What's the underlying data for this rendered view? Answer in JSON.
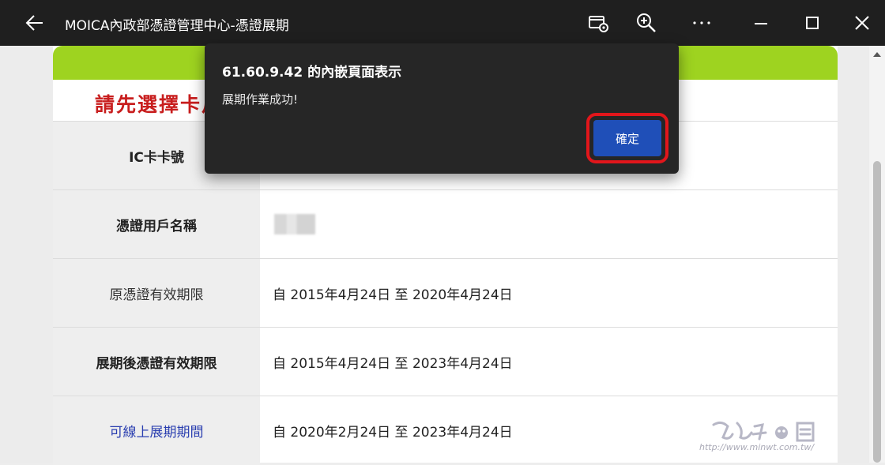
{
  "window": {
    "title": "MOICA內政部憑證管理中心-憑證展期"
  },
  "titlebar_icons": [
    "back-arrow-icon",
    "app-settings-icon",
    "zoom-in-icon",
    "more-icon",
    "minimize-icon",
    "maximize-icon",
    "close-icon"
  ],
  "page": {
    "heading": "請先選擇卡片",
    "rows": [
      {
        "label": "IC卡卡號",
        "value": ""
      },
      {
        "label": "憑證用戶名稱",
        "value": ""
      },
      {
        "label": "原憑證有效期限",
        "from_word": "自",
        "from": "2015年4月24日",
        "to_word": "至",
        "to": "2020年4月24日"
      },
      {
        "label": "展期後憑證有效期限",
        "from_word": "自",
        "from": "2015年4月24日",
        "to_word": "至",
        "to": "2023年4月24日"
      },
      {
        "label": "可線上展期期間",
        "from_word": "自",
        "from": "2020年2月24日",
        "to_word": "至",
        "to": "2023年4月24日"
      }
    ]
  },
  "dialog": {
    "title": "61.60.9.42 的內嵌頁面表示",
    "message": "展期作業成功!",
    "ok_label": "確定"
  },
  "colors": {
    "titlebar_bg": "#1f1f1f",
    "green_band": "#9ed320",
    "heading_red": "#c81e1e",
    "link_blue": "#2b3fb0",
    "dialog_bg": "#262626",
    "ok_button": "#1f4fb8",
    "highlight_red": "#e2161b"
  },
  "watermark": {
    "url": "http://www.minwt.com.tw/"
  }
}
